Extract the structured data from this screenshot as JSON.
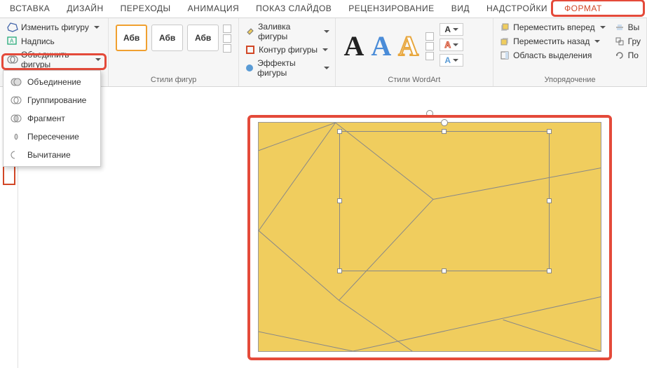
{
  "tabs": {
    "items": [
      "ВСТАВКА",
      "ДИЗАЙН",
      "ПЕРЕХОДЫ",
      "АНИМАЦИЯ",
      "ПОКАЗ СЛАЙДОВ",
      "РЕЦЕНЗИРОВАНИЕ",
      "ВИД",
      "НАДСТРОЙКИ",
      "ФОРМАТ"
    ],
    "active": "ФОРМАТ"
  },
  "ribbon": {
    "insert": {
      "edit_shape": "Изменить фигуру",
      "textbox": "Надпись",
      "merge_shapes": "Объединить фигуры"
    },
    "styles": {
      "label": "Стили фигур",
      "sample": "Абв"
    },
    "fill": {
      "fill": "Заливка фигуры",
      "outline": "Контур фигуры",
      "effects": "Эффекты фигуры"
    },
    "wordart": {
      "label": "Стили WordArt",
      "sample": "A"
    },
    "arrange": {
      "label": "Упорядочение",
      "bring_forward": "Переместить вперед",
      "send_backward": "Переместить назад",
      "selection_pane": "Область выделения",
      "align": "Вы",
      "group": "Гру",
      "rotate": "По"
    }
  },
  "menu": {
    "items": [
      {
        "id": "union",
        "label": "Объединение"
      },
      {
        "id": "combine",
        "label": "Группирование"
      },
      {
        "id": "fragment",
        "label": "Фрагмент"
      },
      {
        "id": "intersect",
        "label": "Пересечение"
      },
      {
        "id": "subtract",
        "label": "Вычитание"
      }
    ],
    "highlighted": "fragment"
  },
  "colors": {
    "accent": "#d24726",
    "highlight": "#e44a3a",
    "shape_fill": "#f0cd5e"
  }
}
